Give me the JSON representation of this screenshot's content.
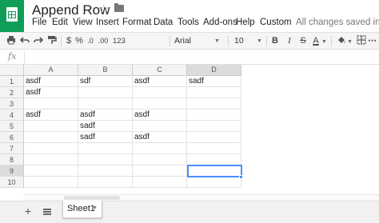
{
  "title": "Append Row",
  "status": "All changes saved in D...",
  "menu": [
    "File",
    "Edit",
    "View",
    "Insert",
    "Format",
    "Data",
    "Tools",
    "Add-ons",
    "Help",
    "Custom"
  ],
  "toolbar": {
    "currency": "$",
    "percent": "%",
    "decrease_decimals": ".0",
    "increase_decimals": ".00",
    "more_formats": "123",
    "font": "Arial",
    "font_size": "10",
    "bold": "B",
    "italic": "I",
    "strike": "S",
    "text_color": "A",
    "text_color_value": "#000000"
  },
  "formula_bar": {
    "label": "fx",
    "value": ""
  },
  "grid": {
    "columns": [
      "A",
      "B",
      "C",
      "D"
    ],
    "rows": [
      "1",
      "2",
      "3",
      "4",
      "5",
      "6",
      "7",
      "8",
      "9",
      "10"
    ],
    "selected_cell": "D9",
    "cells": [
      [
        "asdf",
        "sdf",
        "asdf",
        "sadf"
      ],
      [
        "asdf",
        "",
        "",
        ""
      ],
      [
        "",
        "",
        "",
        ""
      ],
      [
        "asdf",
        "asdf",
        "asdf",
        ""
      ],
      [
        "",
        "sadf",
        "",
        ""
      ],
      [
        "",
        "sadf",
        "asdf",
        ""
      ],
      [
        "",
        "",
        "",
        ""
      ],
      [
        "",
        "",
        "",
        ""
      ],
      [
        "",
        "",
        "",
        ""
      ],
      [
        "",
        "",
        "",
        ""
      ]
    ]
  },
  "sheets": {
    "add_icon": "plus-icon",
    "list_icon": "sheet-list-icon",
    "tabs": [
      "Sheet1"
    ]
  }
}
